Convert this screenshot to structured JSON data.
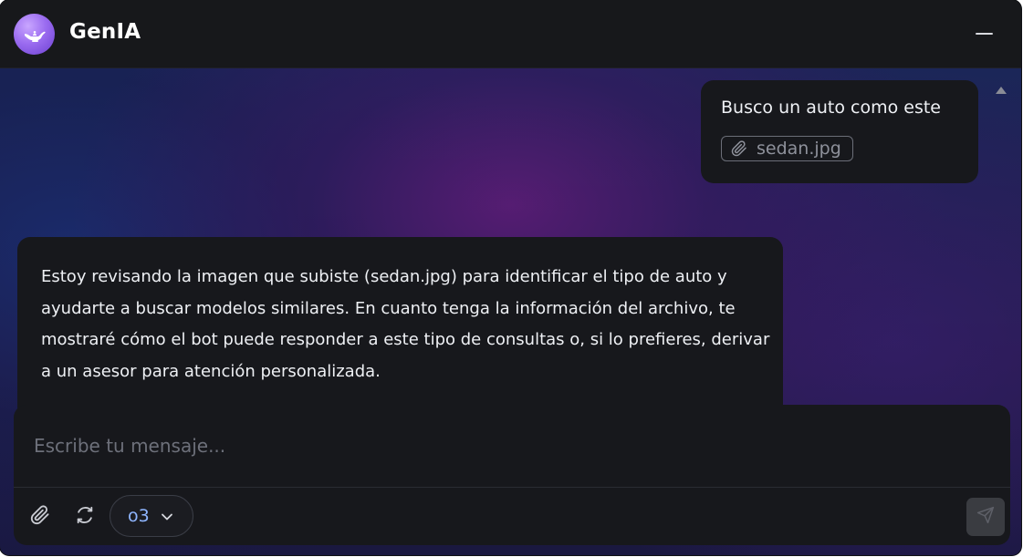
{
  "header": {
    "app_title": "GenIA",
    "logo_icon": "genie-lamp-icon",
    "minimize_icon": "minimize-icon"
  },
  "messages": [
    {
      "role": "user",
      "text": "Busco un auto como este",
      "attachment": {
        "icon": "paperclip-icon",
        "filename": "sedan.jpg"
      }
    },
    {
      "role": "bot",
      "text": "Estoy revisando la imagen que subiste (sedan.jpg) para identificar el tipo de auto y ayudarte a buscar modelos similares. En cuanto tenga la información del archivo, te mostraré cómo el bot puede responder a este tipo de consultas o, si lo prefieres, derivar a un asesor para atención personalizada."
    }
  ],
  "composer": {
    "placeholder": "Escribe tu mensaje...",
    "value": "",
    "attach_icon": "paperclip-icon",
    "reset_icon": "refresh-icon",
    "model_selected": "o3",
    "model_chevron_icon": "chevron-down-icon",
    "send_icon": "send-icon"
  },
  "colors": {
    "window_bg": "#17181c",
    "text_primary": "#eef0f4",
    "placeholder": "#6d707a",
    "model_accent": "#8fb6ff",
    "send_button_disabled": "#3a3c41",
    "logo_purple": "#9b6cf0"
  }
}
